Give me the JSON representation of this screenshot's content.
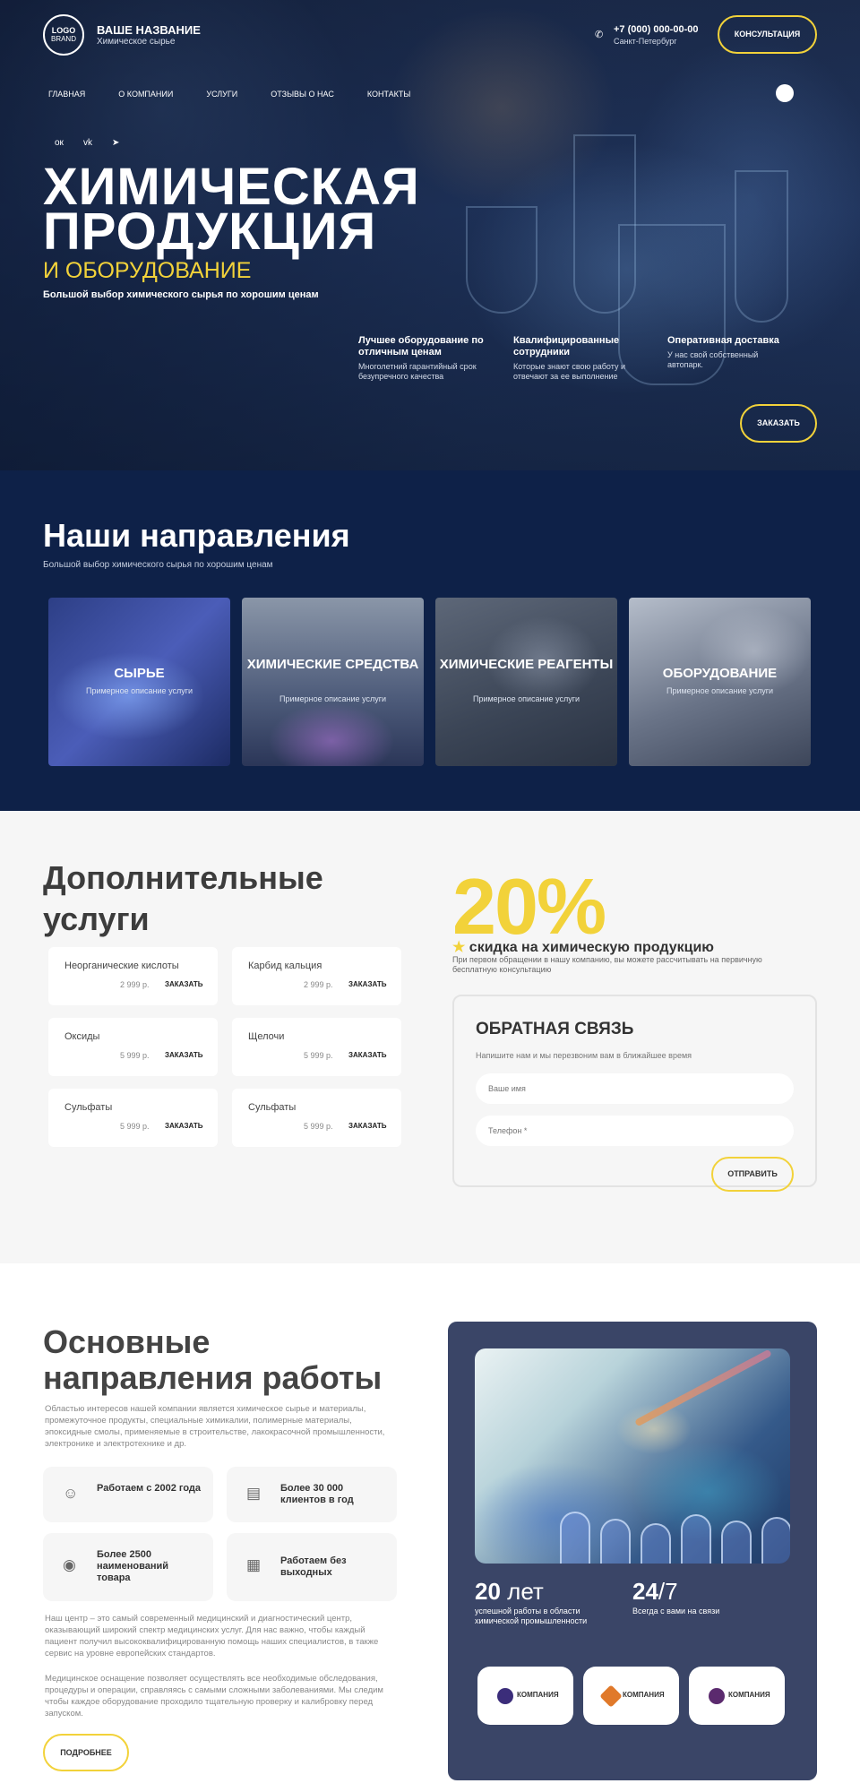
{
  "header": {
    "logo_top": "LOGO",
    "logo_bottom": "BRAND",
    "brand_name": "ВАШЕ НАЗВАНИЕ",
    "brand_sub": "Химическое сырье",
    "phone": "+7 (000) 000-00-00",
    "city": "Санкт-Петербург",
    "consult_button": "КОНСУЛЬТАЦИЯ"
  },
  "nav": [
    "ГЛАВНАЯ",
    "О КОМПАНИИ",
    "УСЛУГИ",
    "ОТЗЫВЫ О НАС",
    "КОНТАКТЫ"
  ],
  "hero": {
    "title_line1": "ХИМИЧЕСКАЯ",
    "title_line2": "ПРОДУКЦИЯ",
    "subtitle": "И ОБОРУДОВАНИЕ",
    "desc": "Большой выбор химического сырья по хорошим ценам",
    "features": [
      {
        "title": "Лучшее оборудование по отличным ценам",
        "desc": "Многолетний гарантийный срок безупречного качества"
      },
      {
        "title": "Квалифицированные сотрудники",
        "desc": "Которые знают свою работу и отвечают за ее выполнение"
      },
      {
        "title": "Оперативная доставка",
        "desc": "У нас свой собственный автопарк."
      }
    ],
    "order_button": "ЗАКАЗАТЬ"
  },
  "directions": {
    "title": "Наши направления",
    "subtitle": "Большой выбор химического сырья по хорошим ценам",
    "cards": [
      {
        "title": "СЫРЬЕ",
        "desc": "Примерное описание услуги"
      },
      {
        "title": "ХИМИЧЕСКИЕ СРЕДСТВА",
        "desc": "Примерное описание услуги"
      },
      {
        "title": "ХИМИЧЕСКИЕ РЕАГЕНТЫ",
        "desc": "Примерное описание услуги"
      },
      {
        "title": "ОБОРУДОВАНИЕ",
        "desc": "Примерное описание услуги"
      }
    ]
  },
  "services": {
    "title_line1": "Дополнительные",
    "title_line2": "услуги",
    "items": [
      {
        "name": "Неорганические кислоты",
        "price": "2 999 р.",
        "order": "ЗАКАЗАТЬ"
      },
      {
        "name": "Карбид кальция",
        "price": "2 999 р.",
        "order": "ЗАКАЗАТЬ"
      },
      {
        "name": "Оксиды",
        "price": "5 999 р.",
        "order": "ЗАКАЗАТЬ"
      },
      {
        "name": "Щелочи",
        "price": "5 999 р.",
        "order": "ЗАКАЗАТЬ"
      },
      {
        "name": "Сульфаты",
        "price": "5 999 р.",
        "order": "ЗАКАЗАТЬ"
      },
      {
        "name": "Сульфаты",
        "price": "5 999 р.",
        "order": "ЗАКАЗАТЬ"
      }
    ],
    "discount_value": "20%",
    "discount_text": "скидка на химическую продукцию",
    "discount_desc": "При первом обращении в нашу компанию, вы можете рассчитывать на первичную бесплатную консультацию"
  },
  "form": {
    "title": "ОБРАТНАЯ СВЯЗЬ",
    "subtitle": "Напишите нам и мы перезвоним вам в ближайшее время",
    "name_placeholder": "Ваше имя",
    "phone_placeholder": "Телефон *",
    "submit": "ОТПРАВИТЬ"
  },
  "work": {
    "title_line1": "Основные",
    "title_line2": "направления работы",
    "intro": "Областью интересов нашей компании является химическое сырье и материалы, промежуточное продукты, специальные химикалии, полимерные материалы, эпоксидные смолы, применяемые в строительстве, лакокрасочной промышленности, электронике и электротехнике и др.",
    "stats": [
      {
        "icon": "worker-icon",
        "text": "Работаем с 2002 года"
      },
      {
        "icon": "clients-icon",
        "text": "Более 30 000 клиентов в год"
      },
      {
        "icon": "products-icon",
        "text": "Более 2500 наименований товара"
      },
      {
        "icon": "calendar-icon",
        "text": "Работаем без выходных"
      }
    ],
    "para2": "Наш центр – это самый современный медицинский и диагностический центр, оказывающий широкий спектр медицинских услуг. Для нас важно, чтобы каждый пациент получил высококвалифицированную помощь наших специалистов, в также сервис на уровне европейских стандартов.",
    "para3": "Медицинское оснащение позволяет осуществлять все необходимые обследования, процедуры и операции, справляясь с самыми сложными заболеваниями. Мы следим чтобы каждое оборудование проходило тщательную проверку и калибровку перед запуском.",
    "more_button": "ПОДРОБНЕЕ",
    "years_num": "20",
    "years_unit": "лет",
    "years_desc": "успешной работы в области химической промышленности",
    "support_num": "24",
    "support_unit": "/7",
    "support_desc": "Всегда с вами на связи",
    "partners": [
      "КОМПАНИЯ",
      "КОМПАНИЯ",
      "КОМПАНИЯ"
    ],
    "partner_colors": [
      "#3b2d7a",
      "#e0792a",
      "#5b2a6e"
    ]
  }
}
